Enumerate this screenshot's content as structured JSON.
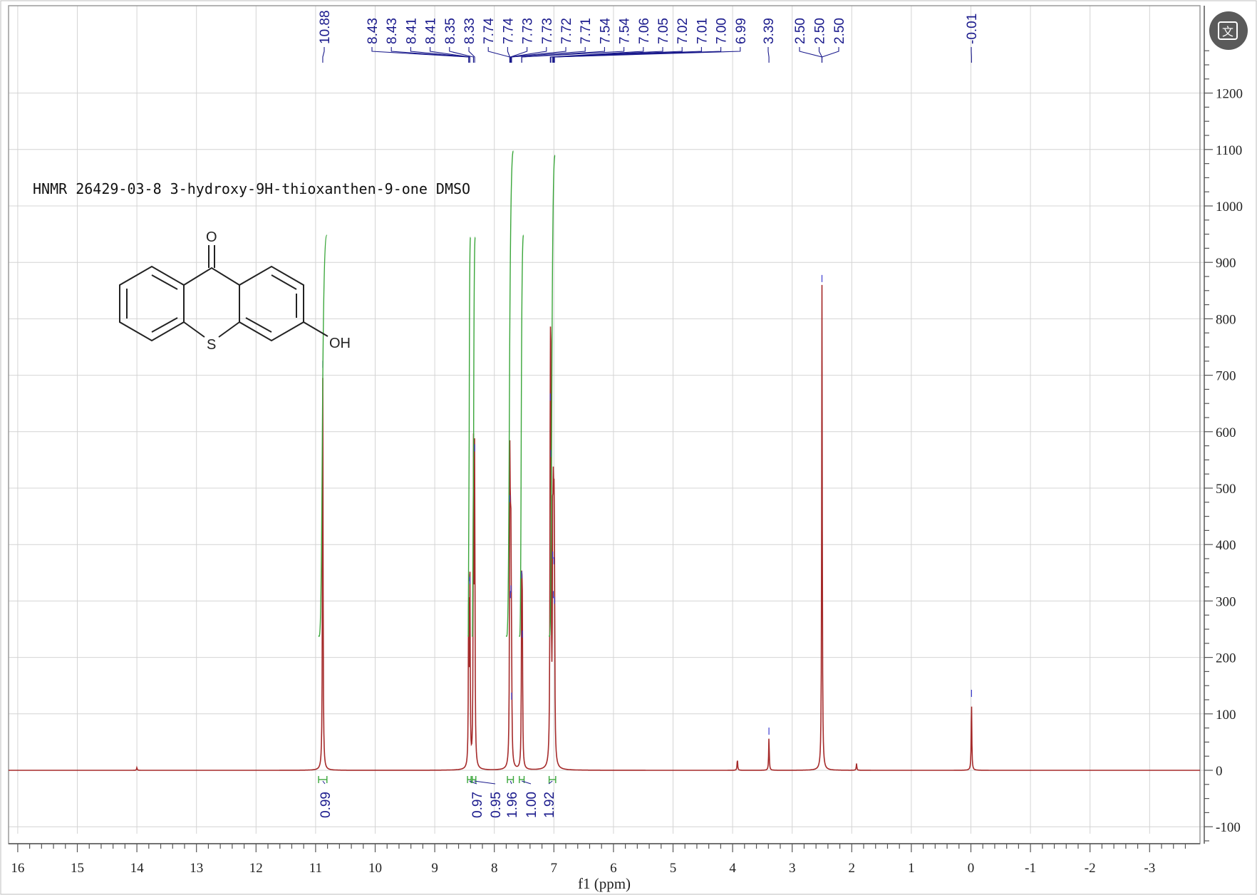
{
  "chart_data": {
    "type": "line",
    "title": "HNMR 26429-03-8 3-hydroxy-9H-thioxanthen-9-one DMSO",
    "xlabel": "f1 (ppm)",
    "ylabel": "",
    "xlim": [
      16.2,
      -3.8
    ],
    "ylim": [
      -130,
      1300
    ],
    "x_reversed": true,
    "grid": true,
    "x_ticks": [
      "16",
      "15",
      "14",
      "13",
      "12",
      "11",
      "10",
      "9",
      "8",
      "7",
      "6",
      "5",
      "4",
      "3",
      "2",
      "1",
      "0",
      "-1",
      "-2",
      "-3"
    ],
    "y_ticks": [
      "1200",
      "1100",
      "1000",
      "900",
      "800",
      "700",
      "600",
      "500",
      "400",
      "300",
      "200",
      "100",
      "0",
      "-100"
    ],
    "spectrum_color": "#a52a2a",
    "peaks": [
      {
        "ppm": 10.88,
        "height": 708
      },
      {
        "ppm": 8.43,
        "height": 330
      },
      {
        "ppm": 8.41,
        "height": 325
      },
      {
        "ppm": 8.35,
        "height": 550
      },
      {
        "ppm": 8.33,
        "height": 560
      },
      {
        "ppm": 7.74,
        "height": 470
      },
      {
        "ppm": 7.73,
        "height": 300
      },
      {
        "ppm": 7.72,
        "height": 310
      },
      {
        "ppm": 7.71,
        "height": 120
      },
      {
        "ppm": 7.54,
        "height": 335
      },
      {
        "ppm": 7.53,
        "height": 230
      },
      {
        "ppm": 7.06,
        "height": 650
      },
      {
        "ppm": 7.05,
        "height": 550
      },
      {
        "ppm": 7.02,
        "height": 370
      },
      {
        "ppm": 7.01,
        "height": 300
      },
      {
        "ppm": 7.0,
        "height": 360
      },
      {
        "ppm": 6.99,
        "height": 290
      },
      {
        "ppm": 3.92,
        "height": 20
      },
      {
        "ppm": 3.39,
        "height": 58
      },
      {
        "ppm": 2.5,
        "height": 860
      },
      {
        "ppm": 1.92,
        "height": 12
      },
      {
        "ppm": -0.01,
        "height": 125
      },
      {
        "ppm": 14.0,
        "height": 5
      }
    ],
    "peak_labels": [
      "10.88",
      "8.43",
      "8.43",
      "8.41",
      "8.41",
      "8.35",
      "8.33",
      "7.74",
      "7.74",
      "7.73",
      "7.73",
      "7.72",
      "7.71",
      "7.54",
      "7.54",
      "7.06",
      "7.05",
      "7.02",
      "7.01",
      "7.00",
      "6.99",
      "3.39",
      "2.50",
      "2.50",
      "2.50",
      "-0.01"
    ],
    "peak_label_ppm": [
      10.88,
      8.43,
      8.43,
      8.41,
      8.41,
      8.35,
      8.33,
      7.74,
      7.74,
      7.73,
      7.73,
      7.72,
      7.71,
      7.54,
      7.54,
      7.06,
      7.05,
      7.02,
      7.01,
      7.0,
      6.99,
      3.39,
      2.5,
      2.5,
      2.5,
      -0.01
    ],
    "integrals": [
      {
        "from": 10.95,
        "to": 10.81,
        "value": "0.99"
      },
      {
        "from": 8.45,
        "to": 8.39,
        "value": "0.97"
      },
      {
        "from": 8.37,
        "to": 8.31,
        "value": "0.95"
      },
      {
        "from": 7.78,
        "to": 7.68,
        "value": "1.96"
      },
      {
        "from": 7.58,
        "to": 7.5,
        "value": "1.00"
      },
      {
        "from": 7.08,
        "to": 6.97,
        "value": "1.92"
      }
    ],
    "colors": {
      "spectrum": "#a52a2a",
      "labels": "#1a1a8c",
      "integral": "#3aa63a"
    }
  },
  "molecule": {
    "atoms": {
      "carbonyl_o": "O",
      "sulfur": "S",
      "hydroxyl": "OH"
    }
  },
  "toolbar": {
    "translate_icon": "translate-icon",
    "translate_glyph": "文"
  }
}
